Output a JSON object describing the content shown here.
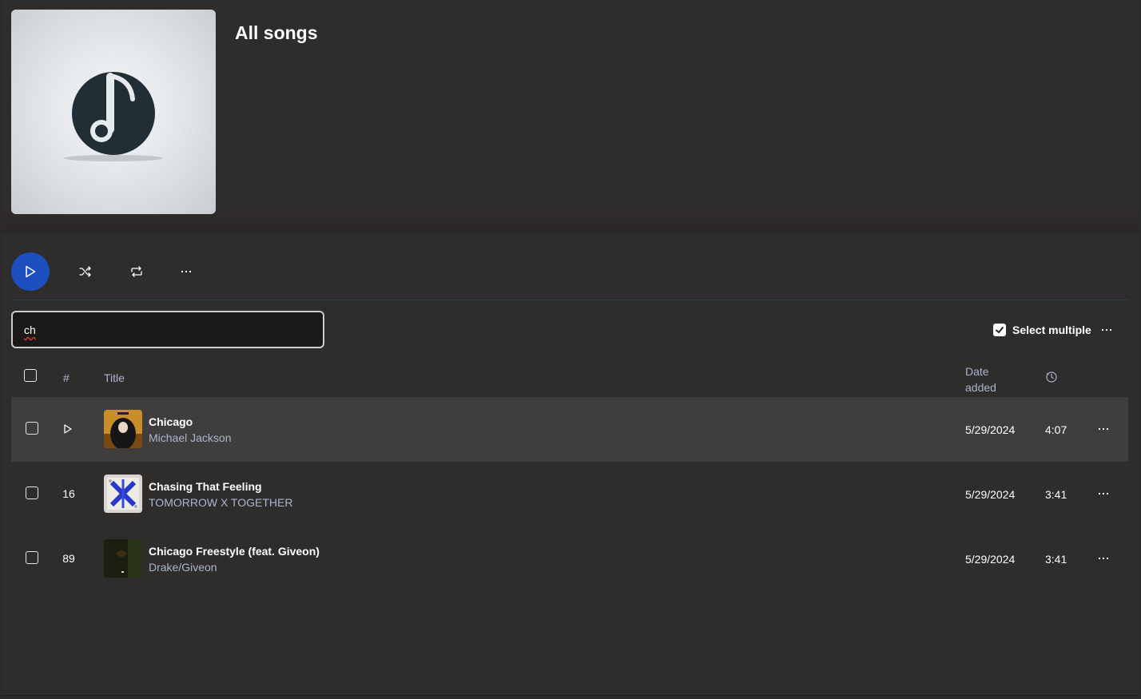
{
  "header": {
    "title": "All songs"
  },
  "toolbar": {
    "play_icon": "play-icon",
    "shuffle_icon": "shuffle-icon",
    "repeat_icon": "repeat-icon",
    "more_icon": "more-horizontal-icon"
  },
  "search": {
    "value": "ch"
  },
  "select_multiple": {
    "label": "Select multiple",
    "checked": true
  },
  "table": {
    "columns": {
      "number": "#",
      "title": "Title",
      "date_added_line1": "Date",
      "date_added_line2": "added",
      "duration_icon": "clock-icon"
    },
    "rows": [
      {
        "number": "",
        "hovered": true,
        "title": "Chicago",
        "artist": "Michael Jackson",
        "date_added": "5/29/2024",
        "duration": "4:07"
      },
      {
        "number": "16",
        "hovered": false,
        "title": "Chasing That Feeling",
        "artist": "TOMORROW X TOGETHER",
        "date_added": "5/29/2024",
        "duration": "3:41"
      },
      {
        "number": "89",
        "hovered": false,
        "title": "Chicago Freestyle (feat. Giveon)",
        "artist": "Drake/Giveon",
        "date_added": "5/29/2024",
        "duration": "3:41"
      }
    ]
  },
  "colors": {
    "accent": "#1e4fbf",
    "background": "#2f2c2c",
    "row_highlight": "#403d3d",
    "secondary_text": "#a9b6cf"
  }
}
